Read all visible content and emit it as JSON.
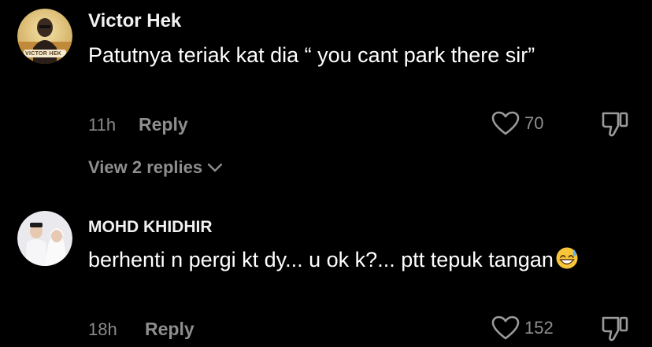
{
  "comments": [
    {
      "username": "Victor Hek",
      "avatar_badge_text": "VICTOR HEK",
      "text": "Patutnya teriak kat dia “ you cant park there sir”",
      "time": "11h",
      "reply_label": "Reply",
      "likes": "70",
      "view_replies": "View 2 replies"
    },
    {
      "username": "MOHD KHIDHIR",
      "text": "berhenti n pergi kt dy... u ok k?... ptt tepuk tangan",
      "time": "18h",
      "reply_label": "Reply",
      "likes": "152"
    }
  ],
  "icons": {
    "like": "heart-outline-icon",
    "dislike": "thumbs-down-outline-icon",
    "expand": "chevron-down-icon",
    "emoji": "grinning-sweat-emoji"
  },
  "colors": {
    "background": "#000000",
    "text_primary": "#ffffff",
    "text_secondary": "#8e8e8e"
  }
}
